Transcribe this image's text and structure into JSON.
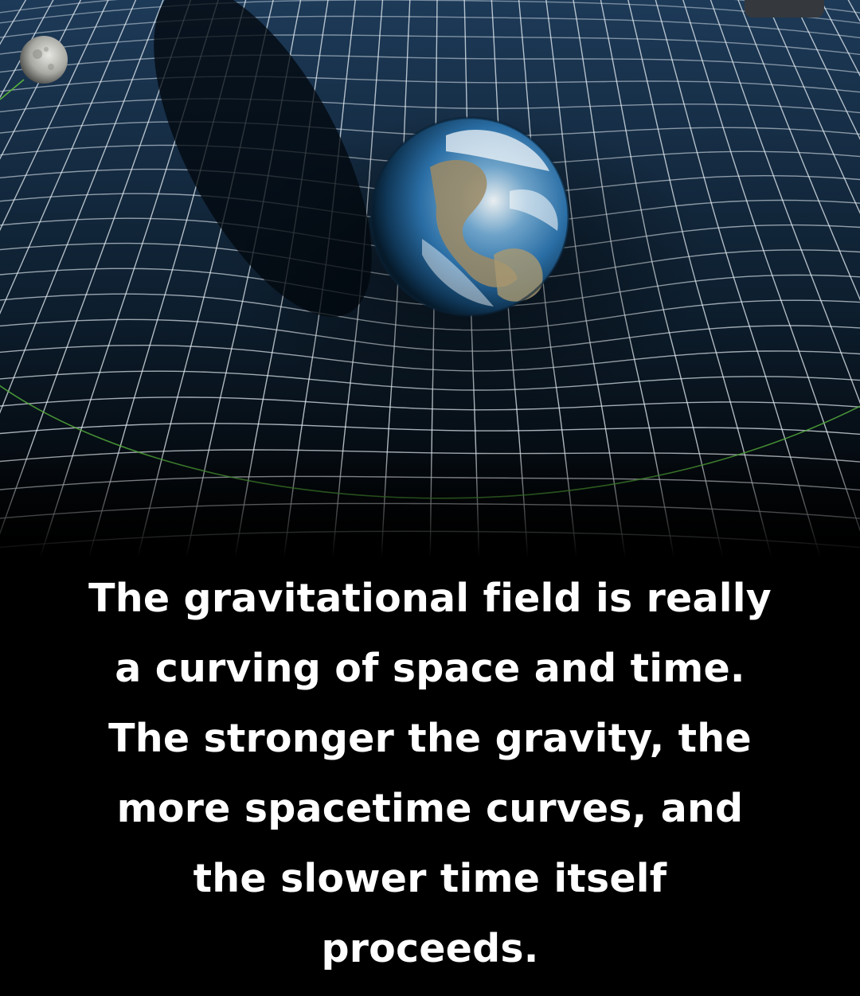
{
  "caption": {
    "lines": [
      "The gravitational field is really",
      "a curving of space and time.",
      "The stronger the gravity, the",
      "more spacetime curves, and",
      "the slower time itself",
      "proceeds."
    ]
  },
  "scene": {
    "objects": [
      "moon",
      "earth",
      "spacetime-grid",
      "orbit-line",
      "earth-shadow"
    ],
    "colors": {
      "space_top": "#1a3552",
      "space_bottom": "#03080d",
      "grid_line": "#e8f0f6",
      "orbit_line": "#56b23c",
      "ocean": "#2f74b6",
      "land": "#9c8a64"
    }
  }
}
